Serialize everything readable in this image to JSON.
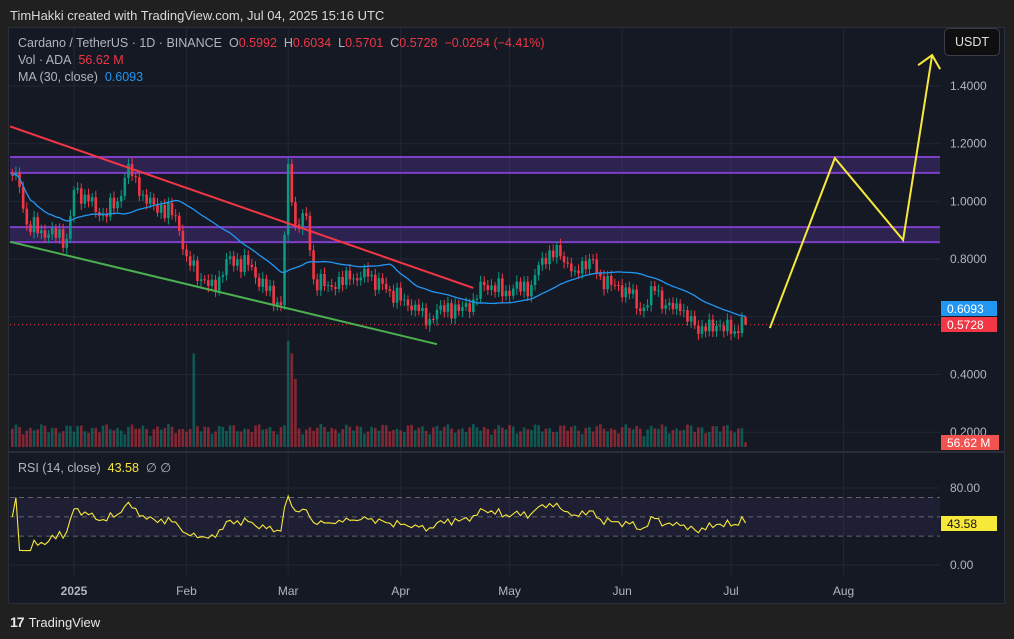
{
  "credit": "TimHakki created with TradingView.com, Jul 04, 2025 15:16 UTC",
  "legend": {
    "symbol": "Cardano / TetherUS · 1D · BINANCE",
    "o_label": "O",
    "o": "0.5992",
    "h_label": "H",
    "h": "0.6034",
    "l_label": "L",
    "l": "0.5701",
    "c_label": "C",
    "c": "0.5728",
    "change": "−0.0264 (−4.41%)",
    "vol_label": "Vol · ADA",
    "vol": "56.62 M",
    "ma_label": "MA (30, close)",
    "ma": "0.6093",
    "rsi_label": "RSI (14, close)",
    "rsi": "43.58",
    "rsi_extra": "∅ ∅"
  },
  "currency_button": "USDT",
  "price_tags": {
    "ma": "0.6093",
    "close": "0.5728",
    "volume": "56.62 M",
    "rsi": "43.58"
  },
  "brand": "TradingView",
  "colors": {
    "up": "#089981",
    "down": "#f23645",
    "ma": "#2196f3",
    "rsi": "#f7e93a",
    "zone": "#673ab7",
    "resistance": "#f23645",
    "support": "#4caf50",
    "projection": "#f7e93a"
  },
  "chart_data": {
    "type": "candlestick",
    "title": "Cardano / TetherUS · 1D · BINANCE",
    "x_unit": "days since 2025-01-01",
    "x_range": [
      -18,
      239
    ],
    "x_ticks": [
      {
        "day": 0,
        "label": "2025"
      },
      {
        "day": 31,
        "label": "Feb"
      },
      {
        "day": 59,
        "label": "Mar"
      },
      {
        "day": 90,
        "label": "Apr"
      },
      {
        "day": 120,
        "label": "May"
      },
      {
        "day": 151,
        "label": "Jun"
      },
      {
        "day": 181,
        "label": "Jul"
      },
      {
        "day": 212,
        "label": "Aug"
      }
    ],
    "price_ticks": [
      "1.4000",
      "1.2000",
      "1.0000",
      "0.8000",
      "0.4000",
      "0.2000"
    ],
    "price_tick_values": [
      1.4,
      1.2,
      1.0,
      0.8,
      0.4,
      0.2
    ],
    "y_range": [
      0.15,
      1.6
    ],
    "close_keypoints": [
      [
        -17,
        1.09
      ],
      [
        -15,
        1.05
      ],
      [
        -13,
        0.92
      ],
      [
        -9,
        0.9
      ],
      [
        -2,
        0.87
      ],
      [
        0,
        1.04
      ],
      [
        4,
        1.0
      ],
      [
        7,
        0.95
      ],
      [
        12,
        1.0
      ],
      [
        15,
        1.13
      ],
      [
        18,
        1.02
      ],
      [
        22,
        0.99
      ],
      [
        28,
        0.95
      ],
      [
        31,
        0.81
      ],
      [
        35,
        0.73
      ],
      [
        39,
        0.69
      ],
      [
        42,
        0.8
      ],
      [
        48,
        0.78
      ],
      [
        53,
        0.69
      ],
      [
        57,
        0.64
      ],
      [
        59,
        1.13
      ],
      [
        61,
        0.92
      ],
      [
        64,
        0.95
      ],
      [
        66,
        0.73
      ],
      [
        70,
        0.71
      ],
      [
        76,
        0.73
      ],
      [
        81,
        0.74
      ],
      [
        87,
        0.69
      ],
      [
        91,
        0.66
      ],
      [
        95,
        0.62
      ],
      [
        97,
        0.57
      ],
      [
        101,
        0.64
      ],
      [
        106,
        0.62
      ],
      [
        110,
        0.66
      ],
      [
        113,
        0.71
      ],
      [
        119,
        0.69
      ],
      [
        126,
        0.71
      ],
      [
        128,
        0.78
      ],
      [
        131,
        0.83
      ],
      [
        134,
        0.81
      ],
      [
        138,
        0.76
      ],
      [
        142,
        0.8
      ],
      [
        145,
        0.74
      ],
      [
        149,
        0.71
      ],
      [
        153,
        0.68
      ],
      [
        156,
        0.62
      ],
      [
        160,
        0.69
      ],
      [
        163,
        0.64
      ],
      [
        167,
        0.62
      ],
      [
        171,
        0.57
      ],
      [
        174,
        0.55
      ],
      [
        178,
        0.57
      ],
      [
        182,
        0.55
      ],
      [
        184,
        0.5992
      ],
      [
        185,
        0.5728
      ]
    ],
    "last_candle": {
      "open": 0.5992,
      "high": 0.6034,
      "low": 0.5701,
      "close": 0.5728
    },
    "ma_period": 30,
    "ma_last": 0.6093,
    "volume_last_millions": 56.62,
    "volume_spikes_millions": [
      [
        33,
        1100
      ],
      [
        59,
        1250
      ],
      [
        60,
        1100
      ],
      [
        61,
        800
      ]
    ],
    "rsi": {
      "period": 14,
      "last": 43.58,
      "ticks": [
        "80.00",
        "0.00"
      ],
      "tick_values": [
        80,
        0
      ],
      "band": [
        30,
        70
      ]
    },
    "zones": [
      {
        "top": 1.154,
        "bottom": 1.099
      },
      {
        "top": 0.911,
        "bottom": 0.859
      }
    ],
    "trendlines": [
      {
        "name": "resistance",
        "from": [
          -17.6,
          1.26
        ],
        "to": [
          110,
          0.7
        ]
      },
      {
        "name": "support",
        "from": [
          -17.6,
          0.86
        ],
        "to": [
          100,
          0.505
        ]
      }
    ],
    "projection_path": [
      [
        191.7,
        0.561
      ],
      [
        209.6,
        1.15
      ],
      [
        228.4,
        0.866
      ],
      [
        236.4,
        1.507
      ]
    ]
  }
}
